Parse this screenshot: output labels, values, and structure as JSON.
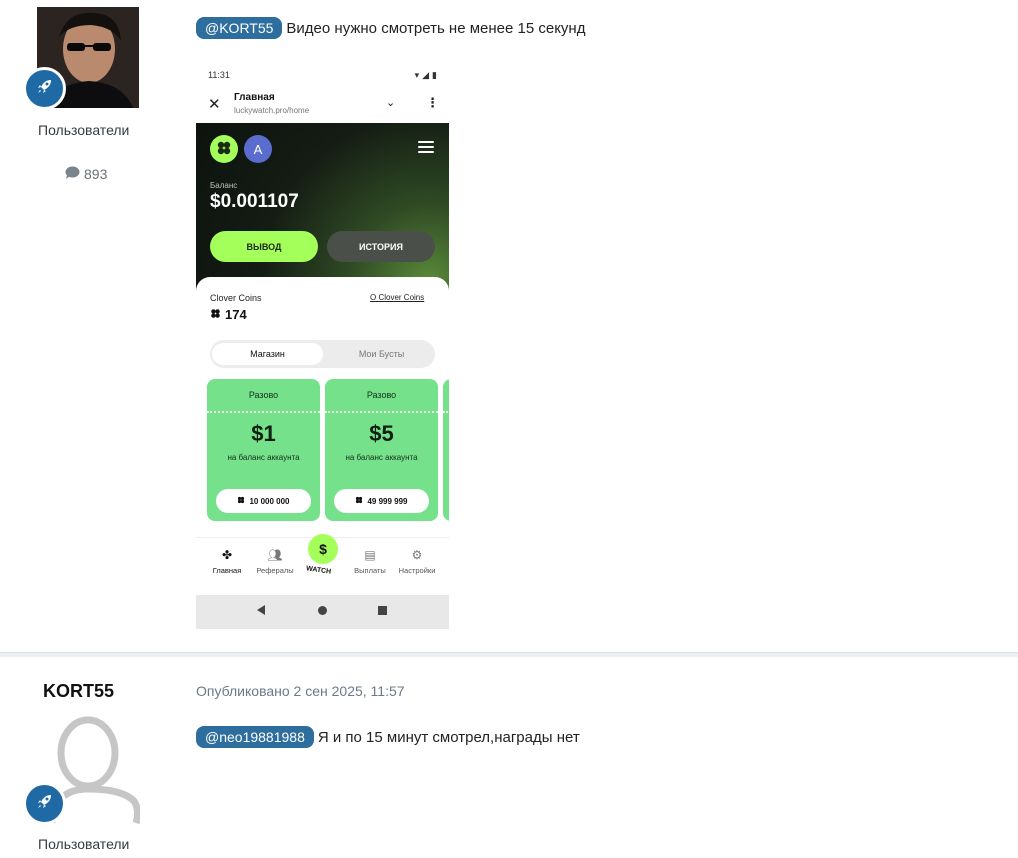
{
  "post1": {
    "author_group": "Пользователи",
    "post_count": "893",
    "mention": "@KORT55",
    "text": "Видео нужно смотреть не менее 15 секунд",
    "attachment": {
      "status_bar": {
        "time": "11:31"
      },
      "browser": {
        "title": "Главная",
        "url": "luckywatch.pro/home"
      },
      "app": {
        "avatar_letter": "A",
        "balance_label": "Баланс",
        "balance_value": "$0.001107",
        "withdraw_label": "ВЫВОД",
        "history_label": "ИСТОРИЯ",
        "clover_title": "Clover Coins",
        "clover_link": "О Clover Coins",
        "clover_value": "174",
        "tabs": [
          "Магазин",
          "Мои Бусты"
        ],
        "offers": [
          {
            "top": "Разово",
            "price": "$1",
            "sub": "на баланс аккаунта",
            "cost": "10 000 000"
          },
          {
            "top": "Разово",
            "price": "$5",
            "sub": "на баланс аккаунта",
            "cost": "49 999 999"
          }
        ],
        "tabbar": {
          "home": "Главная",
          "referrals": "Рефералы",
          "watch": "WATCH",
          "payouts": "Выплаты",
          "settings": "Настройки"
        }
      }
    }
  },
  "post2": {
    "author": "KORT55",
    "author_group": "Пользователи",
    "posted": "Опубликовано 2 сен 2025, 11:57",
    "mention": "@neo19881988",
    "text": "Я и по 15 минут смотрел,награды нет"
  },
  "colors": {
    "mention_bg": "#2d6e9e",
    "rank_badge": "#1f6aa5",
    "app_accent": "#a4ff5a",
    "ticket_green": "#76e18b"
  },
  "icons": {
    "rank": "rocket-icon",
    "post_count": "comment-icon",
    "clover": "clover-icon"
  }
}
